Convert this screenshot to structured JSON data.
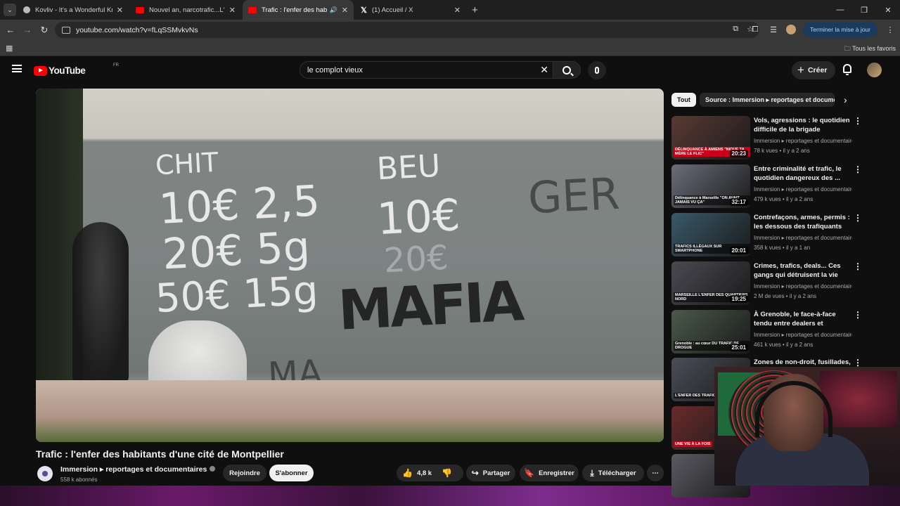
{
  "browser": {
    "tabs": [
      {
        "title": "Kovliv - It's a Wonderful Knife [",
        "icon": "site-icon"
      },
      {
        "title": "Nouvel an, narcotrafic...L'interv",
        "icon": "youtube-icon"
      },
      {
        "title": "Trafic : l'enfer des habitants",
        "icon": "youtube-icon",
        "active": true
      },
      {
        "title": "(1) Accueil / X",
        "icon": "x-icon"
      }
    ],
    "url": "youtube.com/watch?v=fLqSSMvkvNs",
    "update_button": "Terminer la mise à jour",
    "all_favorites": "Tous les favoris"
  },
  "youtube": {
    "logo_text": "YouTube",
    "country_code": "FR",
    "search_value": "le complot vieux",
    "create_label": "Créer"
  },
  "video": {
    "title": "Trafic : l'enfer des habitants d'une cité de Montpellier",
    "channel": "Immersion ▸ reportages et documentaires",
    "subscribers": "558 k abonnés",
    "join_label": "Rejoindre",
    "subscribe_label": "S'abonner",
    "likes": "4,8 k",
    "share_label": "Partager",
    "save_label": "Enregistrer",
    "download_label": "Télécharger",
    "graffiti": [
      "CHIT",
      "10€ 2,5",
      "20€ 5g",
      "50€ 15g",
      "BEU",
      "10€",
      "20€",
      "MAFIA",
      "GER",
      "MA"
    ]
  },
  "chips": [
    {
      "label": "Tout",
      "active": true
    },
    {
      "label": "Source : Immersion ▸ reportages et documentaires",
      "active": false
    }
  ],
  "recommendations": [
    {
      "title": "Vols, agressions : le quotidien difficile de la brigade nocturne...",
      "channel": "Immersion ▸ reportages et documentaires",
      "views": "78 k vues",
      "age": "il y a 2 ans",
      "duration": "20:23",
      "caption": "DÉLINQUANCE À AMIENS \"NIQUE TA MÈRE LE FLIC\"",
      "color": "#5a3a34"
    },
    {
      "title": "Entre criminalité et trafic, le quotidien dangereux des ...",
      "channel": "Immersion ▸ reportages et documentaires",
      "views": "479 k vues",
      "age": "il y a 2 ans",
      "duration": "32:17",
      "caption": "Délinquance à Marseille \"ON AVAIT JAMAIS VU ÇA\"",
      "color": "#6a6e7a"
    },
    {
      "title": "Contrefaçons, armes, permis : les dessous des trafiquants",
      "channel": "Immersion ▸ reportages et documentaires",
      "views": "358 k vues",
      "age": "il y a 1 an",
      "duration": "20:01",
      "caption": "TRAFICS ILLÉGAUX SUR SMARTPHONE",
      "color": "#3a5a6a"
    },
    {
      "title": "Crimes, trafics, deals... Ces gangs qui détruisent la vie des...",
      "channel": "Immersion ▸ reportages et documentaires",
      "views": "2 M de vues",
      "age": "il y a 2 ans",
      "duration": "19:25",
      "caption": "MARSEILLE L'ENFER DES QUARTIERS NORD",
      "color": "#4a4a52"
    },
    {
      "title": "À Grenoble, le face-à-face tendu entre dealers et policiers",
      "channel": "Immersion ▸ reportages et documentaires",
      "views": "461 k vues",
      "age": "il y a 2 ans",
      "duration": "25:01",
      "caption": "Grenoble : au cœur DU TRAFIC DE DROGUE",
      "color": "#4a5a4a"
    },
    {
      "title": "Zones de non-droit, fusillades,",
      "channel": "",
      "views": "",
      "age": "",
      "duration": "",
      "caption": "L'ENFER DES TRAFICS À MARSEILLE",
      "color": "#4a4e58"
    },
    {
      "title": "",
      "channel": "",
      "views": "",
      "age": "",
      "duration": "",
      "caption": "UNE VIE À LA FOIS",
      "color": "#6a2a2a"
    },
    {
      "title": "",
      "channel": "",
      "views": "",
      "age": "",
      "duration": "",
      "caption": "",
      "color": "#5a5a62"
    }
  ]
}
